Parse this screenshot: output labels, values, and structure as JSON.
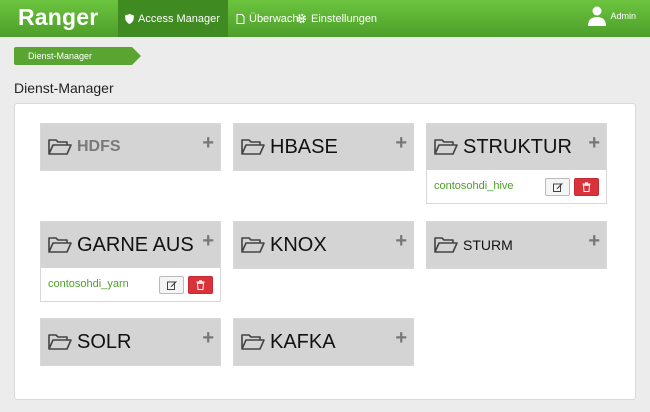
{
  "header": {
    "brand": "Ranger",
    "nav": [
      {
        "label": "Access Manager"
      },
      {
        "label": "Überwachung"
      },
      {
        "label": "Einstellungen"
      }
    ],
    "user": "Admin"
  },
  "breadcrumb": "Dienst-Manager",
  "page_title": "Dienst-Manager",
  "services": [
    {
      "name": "HDFS",
      "repo": ""
    },
    {
      "name": "HBASE",
      "repo": ""
    },
    {
      "name": "STRUKTUR",
      "repo": "contosohdi_hive"
    },
    {
      "name": "GARNE AUS",
      "repo": "contosohdi_yarn"
    },
    {
      "name": "KNOX",
      "repo": ""
    },
    {
      "name": "STURM",
      "repo": ""
    },
    {
      "name": "SOLR",
      "repo": ""
    },
    {
      "name": "KAFKA",
      "repo": ""
    }
  ],
  "add_label": "+",
  "icons": {
    "folder": "folder-open-icon",
    "edit": "edit-icon",
    "delete": "trash-icon",
    "user": "user-icon"
  },
  "colors": {
    "brand_green": "#5aa532",
    "nav_active": "#3f8a21",
    "delete_red": "#d9323a",
    "link_green": "#4d9f2a"
  }
}
